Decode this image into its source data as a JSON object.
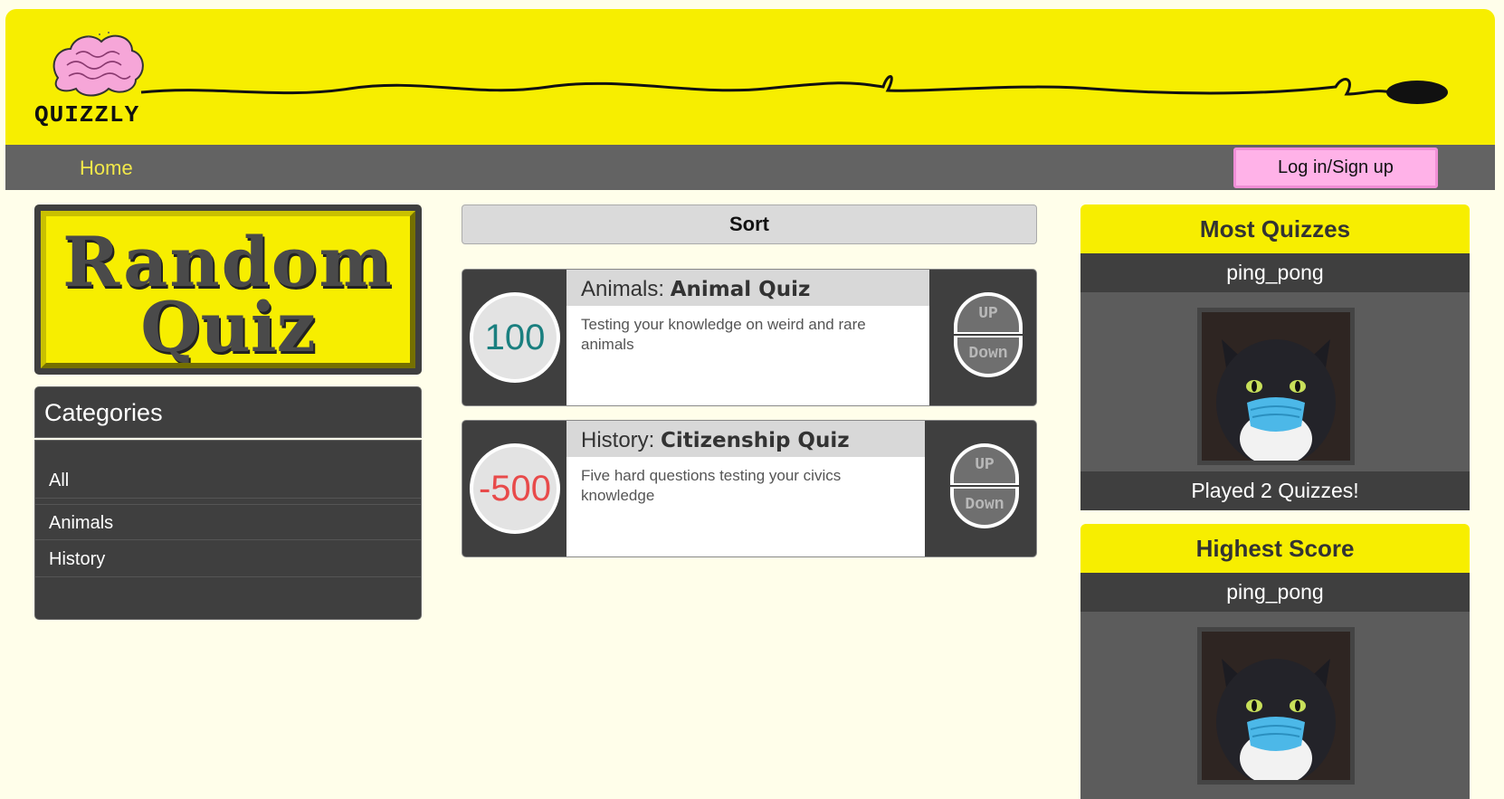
{
  "header": {
    "logo_text": "QUIZZLY"
  },
  "nav": {
    "home_label": "Home",
    "login_label": "Log in/Sign up"
  },
  "random_quiz": {
    "line1": "Random",
    "line2": "Quiz"
  },
  "categories": {
    "title": "Categories",
    "items": [
      "All",
      "Animals",
      "History"
    ]
  },
  "sort": {
    "label": "Sort"
  },
  "quizzes": [
    {
      "score": "100",
      "score_color": "#1a7f7f",
      "category": "Animals: ",
      "title": "Animal Quiz",
      "description": "Testing your knowledge on weird and rare animals",
      "vote_up": "UP",
      "vote_down": "Down"
    },
    {
      "score": "-500",
      "score_color": "#e84a4a",
      "category": "History: ",
      "title": "Citizenship Quiz",
      "description": "Five hard questions testing your civics knowledge",
      "vote_up": "UP",
      "vote_down": "Down"
    }
  ],
  "leaderboards": [
    {
      "heading": "Most Quizzes",
      "username": "ping_pong",
      "footer": "Played 2 Quizzes!",
      "avatar_icon": "cat-with-mask-avatar"
    },
    {
      "heading": "Highest Score",
      "username": "ping_pong",
      "avatar_icon": "cat-with-mask-avatar"
    }
  ],
  "colors": {
    "header_yellow": "#f7ee00",
    "nav_gray": "#636363",
    "page_bg": "#fffeea",
    "login_pink": "#ffb2e8"
  }
}
